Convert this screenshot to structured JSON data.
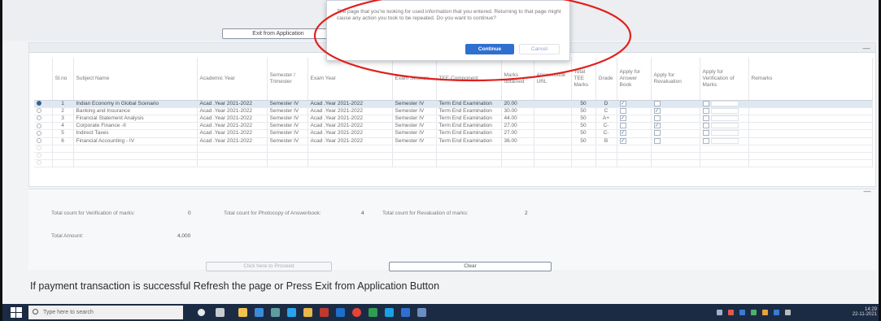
{
  "top": {
    "exit_button": "Exit from Application"
  },
  "dialog": {
    "message": "The page that you're looking for used information that you entered. Returning to that page might cause any action you took to be repeated. Do you want to continue?",
    "continue_label": "Continue",
    "cancel_label": "Cancel"
  },
  "table": {
    "headers": [
      "",
      "Sl.no",
      "Subject Name",
      "Academic Year",
      "Semester / Trimester",
      "Exam Year",
      "Exam Session",
      "TEE Component",
      "Marks obtained",
      "Answerbook URL",
      "Total TEE Marks",
      "Grade",
      "Apply for Answer Book",
      "Apply for Revaluation",
      "Apply for Verification of Marks",
      "Remarks"
    ],
    "rows": [
      {
        "slno": "1",
        "subject": "Indian Economy in Global Scenario",
        "academic_year": "Acad .Year 2021-2022",
        "semester": "Semester IV",
        "exam_year": "Acad .Year 2021-2022",
        "session": "Semester IV",
        "component": "Term End Examination",
        "marks": "20.00",
        "url": "",
        "total": "50",
        "grade": "D",
        "answer_book": true,
        "revaluation": false,
        "verification": false
      },
      {
        "slno": "2",
        "subject": "Banking and Insurance",
        "academic_year": "Acad .Year 2021-2022",
        "semester": "Semester IV",
        "exam_year": "Acad .Year 2021-2022",
        "session": "Semester IV",
        "component": "Term End Examination",
        "marks": "30.00",
        "url": "",
        "total": "50",
        "grade": "C",
        "answer_book": false,
        "revaluation": true,
        "verification": false
      },
      {
        "slno": "3",
        "subject": "Financial Statement Analysis",
        "academic_year": "Acad .Year 2021-2022",
        "semester": "Semester IV",
        "exam_year": "Acad .Year 2021-2022",
        "session": "Semester IV",
        "component": "Term End Examination",
        "marks": "44.00",
        "url": "",
        "total": "50",
        "grade": "A+",
        "answer_book": true,
        "revaluation": false,
        "verification": false
      },
      {
        "slno": "4",
        "subject": "Corporate Finance -II",
        "academic_year": "Acad .Year 2021-2022",
        "semester": "Semester IV",
        "exam_year": "Acad .Year 2021-2022",
        "session": "Semester IV",
        "component": "Term End Examination",
        "marks": "27.00",
        "url": "",
        "total": "50",
        "grade": "C-",
        "answer_book": false,
        "revaluation": true,
        "verification": false
      },
      {
        "slno": "5",
        "subject": "Indirect Taxes",
        "academic_year": "Acad .Year 2021-2022",
        "semester": "Semester IV",
        "exam_year": "Acad .Year 2021-2022",
        "session": "Semester IV",
        "component": "Term End Examination",
        "marks": "27.00",
        "url": "",
        "total": "50",
        "grade": "C-",
        "answer_book": true,
        "revaluation": false,
        "verification": false
      },
      {
        "slno": "6",
        "subject": "Financial Accounting - IV",
        "academic_year": "Acad .Year 2021-2022",
        "semester": "Semester IV",
        "exam_year": "Acad .Year 2021-2022",
        "session": "Semester IV",
        "component": "Term End Examination",
        "marks": "36.00",
        "url": "",
        "total": "50",
        "grade": "B",
        "answer_book": true,
        "revaluation": false,
        "verification": false
      }
    ]
  },
  "totals": {
    "verification_label": "Total count for Verification of marks:",
    "verification_value": "0",
    "photocopy_label": "Total count for Photocopy of Answerbook:",
    "photocopy_value": "4",
    "revaluation_label": "Total count for Revaluation of marks:",
    "revaluation_value": "2",
    "amount_label": "Total Amount:",
    "amount_value": "4,000"
  },
  "buttons": {
    "proceed": "Click here to Proceed",
    "clear": "Clear"
  },
  "instruction": "If payment transaction is successful Refresh the page or Press Exit from Application Button",
  "taskbar": {
    "search_placeholder": "Type here to search",
    "clock_time": "14:29",
    "clock_date": "22-11-2021"
  },
  "colors": {
    "annotation": "#e0201c",
    "primary": "#2f6fd0",
    "taskbar": "#1c2b44"
  }
}
